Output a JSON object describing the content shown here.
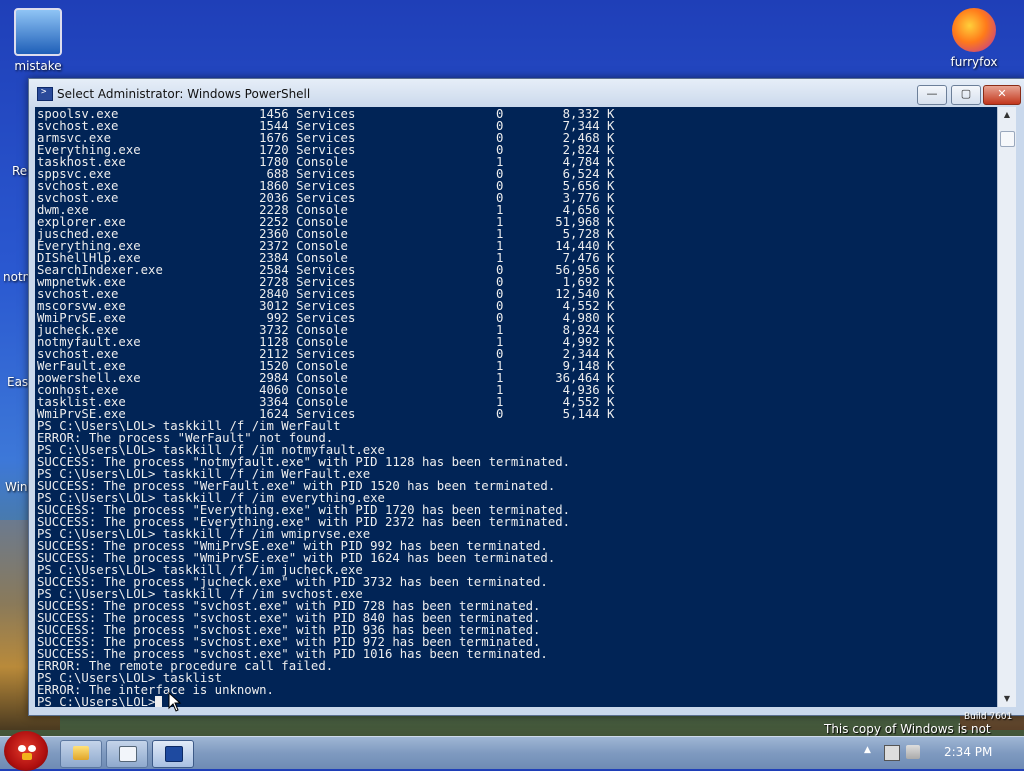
{
  "desktop": {
    "icons": [
      {
        "label": "mistake"
      },
      {
        "label": "furryfox"
      }
    ],
    "partial_labels": [
      "Re",
      "notn",
      "Easy",
      "Win"
    ],
    "watermark": "This copy of Windows is not genuine",
    "watermark_build": "Build 7601"
  },
  "window": {
    "title": "Select Administrator: Windows PowerShell",
    "buttons": {
      "minimize": "—",
      "maximize": "▢",
      "close": "✕"
    }
  },
  "console": {
    "processes": [
      {
        "name": "spoolsv.exe",
        "pid": "1456",
        "session": "Services",
        "num": "0",
        "mem": "8,332 K"
      },
      {
        "name": "svchost.exe",
        "pid": "1544",
        "session": "Services",
        "num": "0",
        "mem": "7,344 K"
      },
      {
        "name": "armsvc.exe",
        "pid": "1676",
        "session": "Services",
        "num": "0",
        "mem": "2,468 K"
      },
      {
        "name": "Everything.exe",
        "pid": "1720",
        "session": "Services",
        "num": "0",
        "mem": "2,824 K"
      },
      {
        "name": "taskhost.exe",
        "pid": "1780",
        "session": "Console",
        "num": "1",
        "mem": "4,784 K"
      },
      {
        "name": "sppsvc.exe",
        "pid": "688",
        "session": "Services",
        "num": "0",
        "mem": "6,524 K"
      },
      {
        "name": "svchost.exe",
        "pid": "1860",
        "session": "Services",
        "num": "0",
        "mem": "5,656 K"
      },
      {
        "name": "svchost.exe",
        "pid": "2036",
        "session": "Services",
        "num": "0",
        "mem": "3,776 K"
      },
      {
        "name": "dwm.exe",
        "pid": "2228",
        "session": "Console",
        "num": "1",
        "mem": "4,656 K"
      },
      {
        "name": "explorer.exe",
        "pid": "2252",
        "session": "Console",
        "num": "1",
        "mem": "51,968 K"
      },
      {
        "name": "jusched.exe",
        "pid": "2360",
        "session": "Console",
        "num": "1",
        "mem": "5,728 K"
      },
      {
        "name": "Everything.exe",
        "pid": "2372",
        "session": "Console",
        "num": "1",
        "mem": "14,440 K"
      },
      {
        "name": "DIShellHlp.exe",
        "pid": "2384",
        "session": "Console",
        "num": "1",
        "mem": "7,476 K"
      },
      {
        "name": "SearchIndexer.exe",
        "pid": "2584",
        "session": "Services",
        "num": "0",
        "mem": "56,956 K"
      },
      {
        "name": "wmpnetwk.exe",
        "pid": "2728",
        "session": "Services",
        "num": "0",
        "mem": "1,692 K"
      },
      {
        "name": "svchost.exe",
        "pid": "2840",
        "session": "Services",
        "num": "0",
        "mem": "12,540 K"
      },
      {
        "name": "mscorsvw.exe",
        "pid": "3012",
        "session": "Services",
        "num": "0",
        "mem": "4,552 K"
      },
      {
        "name": "WmiPrvSE.exe",
        "pid": "992",
        "session": "Services",
        "num": "0",
        "mem": "4,980 K"
      },
      {
        "name": "jucheck.exe",
        "pid": "3732",
        "session": "Console",
        "num": "1",
        "mem": "8,924 K"
      },
      {
        "name": "notmyfault.exe",
        "pid": "1128",
        "session": "Console",
        "num": "1",
        "mem": "4,992 K"
      },
      {
        "name": "svchost.exe",
        "pid": "2112",
        "session": "Services",
        "num": "0",
        "mem": "2,344 K"
      },
      {
        "name": "WerFault.exe",
        "pid": "1520",
        "session": "Console",
        "num": "1",
        "mem": "9,148 K"
      },
      {
        "name": "powershell.exe",
        "pid": "2984",
        "session": "Console",
        "num": "1",
        "mem": "36,464 K"
      },
      {
        "name": "conhost.exe",
        "pid": "4060",
        "session": "Console",
        "num": "1",
        "mem": "4,936 K"
      },
      {
        "name": "tasklist.exe",
        "pid": "3364",
        "session": "Console",
        "num": "1",
        "mem": "4,552 K"
      },
      {
        "name": "WmiPrvSE.exe",
        "pid": "1624",
        "session": "Services",
        "num": "0",
        "mem": "5,144 K"
      }
    ],
    "lines": [
      "PS C:\\Users\\LOL> taskkill /f /im WerFault",
      "ERROR: The process \"WerFault\" not found.",
      "PS C:\\Users\\LOL> taskkill /f /im notmyfault.exe",
      "SUCCESS: The process \"notmyfault.exe\" with PID 1128 has been terminated.",
      "PS C:\\Users\\LOL> taskkill /f /im WerFault.exe",
      "SUCCESS: The process \"WerFault.exe\" with PID 1520 has been terminated.",
      "PS C:\\Users\\LOL> taskkill /f /im everything.exe",
      "SUCCESS: The process \"Everything.exe\" with PID 1720 has been terminated.",
      "SUCCESS: The process \"Everything.exe\" with PID 2372 has been terminated.",
      "PS C:\\Users\\LOL> taskkill /f /im wmiprvse.exe",
      "SUCCESS: The process \"WmiPrvSE.exe\" with PID 992 has been terminated.",
      "SUCCESS: The process \"WmiPrvSE.exe\" with PID 1624 has been terminated.",
      "PS C:\\Users\\LOL> taskkill /f /im jucheck.exe",
      "SUCCESS: The process \"jucheck.exe\" with PID 3732 has been terminated.",
      "PS C:\\Users\\LOL> taskkill /f /im svchost.exe",
      "SUCCESS: The process \"svchost.exe\" with PID 728 has been terminated.",
      "SUCCESS: The process \"svchost.exe\" with PID 840 has been terminated.",
      "SUCCESS: The process \"svchost.exe\" with PID 936 has been terminated.",
      "SUCCESS: The process \"svchost.exe\" with PID 972 has been terminated.",
      "SUCCESS: The process \"svchost.exe\" with PID 1016 has been terminated.",
      "ERROR: The remote procedure call failed.",
      "PS C:\\Users\\LOL> tasklist",
      "ERROR: The interface is unknown."
    ],
    "prompt": "PS C:\\Users\\LOL>"
  },
  "taskbar": {
    "clock": "2:34 PM",
    "tray_arrow": "▲",
    "buttons": [
      {
        "name": "explorer",
        "icon": "folder-icon"
      },
      {
        "name": "window",
        "icon": "window-icon"
      },
      {
        "name": "powershell",
        "icon": "powershell-icon"
      }
    ]
  },
  "colors": {
    "console_bg": "#012456",
    "console_fg": "#eeeeee"
  }
}
